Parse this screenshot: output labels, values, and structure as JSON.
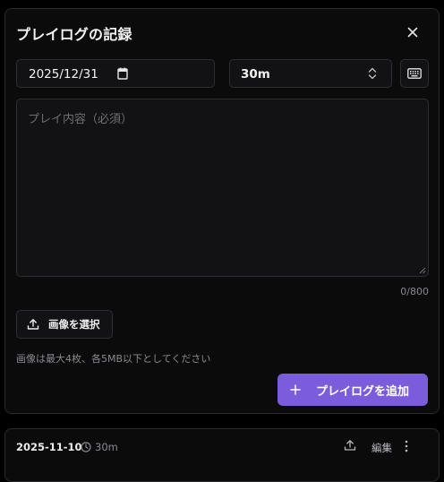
{
  "dialog": {
    "title": "プレイログの記録",
    "close_icon": "close-icon",
    "date_value": "2025/12/31",
    "calendar_icon": "calendar-icon",
    "duration_value": "30m",
    "duration_icon": "chevron-updown-icon",
    "keyboard_icon": "keyboard-icon",
    "content_placeholder": "プレイ内容（必須）",
    "char_counter": "0/800",
    "image_button_label": "画像を選択",
    "upload_icon": "upload-icon",
    "image_hint": "画像は最大4枚、各5MB以下としてください",
    "add_button_label": "プレイログを追加",
    "plus_icon": "plus-icon"
  },
  "entries": [
    {
      "date": "2025-11-10",
      "duration": "30m",
      "edit_label": "編集"
    }
  ],
  "colors": {
    "background": "#000000",
    "panel": "#0b0b0c",
    "field": "#121214",
    "border": "#2e2e32",
    "accent": "#7b5ddb",
    "text_primary": "#f2f2f2",
    "text_muted": "#8a8a90"
  }
}
